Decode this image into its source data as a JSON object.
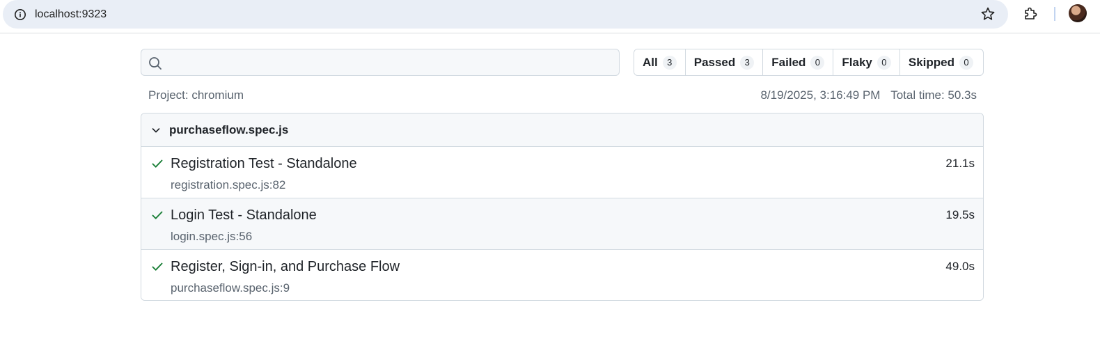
{
  "browser": {
    "url": "localhost:9323"
  },
  "filters": {
    "search_placeholder": "",
    "tabs": [
      {
        "label": "All",
        "count": "3"
      },
      {
        "label": "Passed",
        "count": "3"
      },
      {
        "label": "Failed",
        "count": "0"
      },
      {
        "label": "Flaky",
        "count": "0"
      },
      {
        "label": "Skipped",
        "count": "0"
      }
    ]
  },
  "meta": {
    "project": "Project: chromium",
    "timestamp": "8/19/2025, 3:16:49 PM",
    "total_time": "Total time: 50.3s"
  },
  "suite": {
    "title": "purchaseflow.spec.js",
    "tests": [
      {
        "title": "Registration Test - Standalone",
        "location": "registration.spec.js:82",
        "duration": "21.1s",
        "status": "passed"
      },
      {
        "title": "Login Test - Standalone",
        "location": "login.spec.js:56",
        "duration": "19.5s",
        "status": "passed"
      },
      {
        "title": "Register, Sign-in, and Purchase Flow",
        "location": "purchaseflow.spec.js:9",
        "duration": "49.0s",
        "status": "passed"
      }
    ]
  },
  "colors": {
    "pass_green": "#1a7f37",
    "muted_text": "#59636e",
    "border": "#d1d9e0"
  },
  "icons": {
    "site_info": "info-icon",
    "bookmark": "star-icon",
    "extensions": "puzzle-icon",
    "search": "search-icon",
    "expand": "chevron-down-icon",
    "status": "check-icon"
  }
}
